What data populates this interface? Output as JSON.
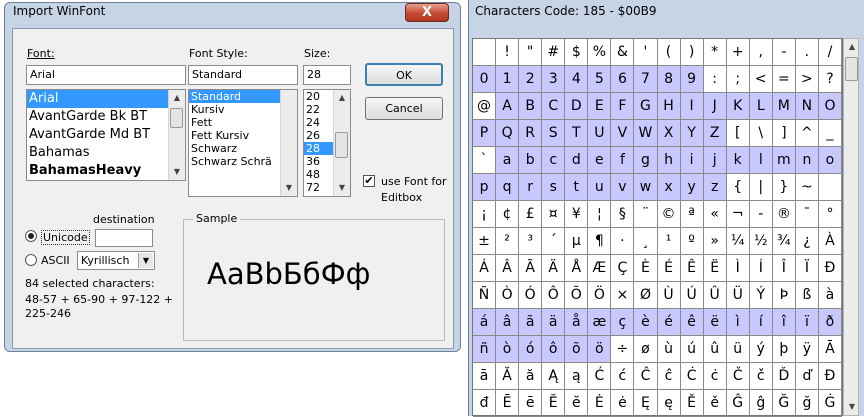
{
  "dialog": {
    "title": "Import WinFont",
    "close_label": "X",
    "font_label": "Font:",
    "font_value": "Arial",
    "fonts": [
      "Arial",
      "AvantGarde Bk BT",
      "AvantGarde Md BT",
      "Bahamas",
      "BahamasHeavy"
    ],
    "selected_font_index": 0,
    "style_label": "Font Style:",
    "style_value": "Standard",
    "styles": [
      "Standard",
      "Kursiv",
      "Fett",
      "Fett Kursiv",
      "Schwarz",
      "Schwarz Schrä"
    ],
    "selected_style_index": 0,
    "size_label": "Size:",
    "size_value": "28",
    "sizes": [
      "20",
      "22",
      "24",
      "26",
      "28",
      "36",
      "48",
      "72"
    ],
    "selected_size_index": 4,
    "ok_label": "OK",
    "cancel_label": "Cancel",
    "use_font_checked": true,
    "use_font_label_1": "use Font for",
    "use_font_label_2": "Editbox",
    "destination_label": "destination",
    "unicode_label": "Unicode",
    "ascii_label": "ASCII",
    "encoding_value": "Kyrillisch",
    "selected_count": "84 selected characters:",
    "ranges_1": "48-57 + 65-90 + 97-122 +",
    "ranges_2": "225-246",
    "sample_label": "Sample",
    "sample_text": "AaBbБбФф",
    "check_mark": "✔"
  },
  "char_panel": {
    "title": "Characters  Code: 185 - $00B9",
    "rows": [
      [
        "",
        "!",
        "\"",
        "#",
        "$",
        "%",
        "&",
        "'",
        "(",
        ")",
        "*",
        "+",
        ",",
        "-",
        ".",
        "/"
      ],
      [
        "0",
        "1",
        "2",
        "3",
        "4",
        "5",
        "6",
        "7",
        "8",
        "9",
        ":",
        ";",
        "<",
        "=",
        ">",
        "?"
      ],
      [
        "@",
        "A",
        "B",
        "C",
        "D",
        "E",
        "F",
        "G",
        "H",
        "I",
        "J",
        "K",
        "L",
        "M",
        "N",
        "O"
      ],
      [
        "P",
        "Q",
        "R",
        "S",
        "T",
        "U",
        "V",
        "W",
        "X",
        "Y",
        "Z",
        "[",
        "\\",
        "]",
        "^",
        "_"
      ],
      [
        "`",
        "a",
        "b",
        "c",
        "d",
        "e",
        "f",
        "g",
        "h",
        "i",
        "j",
        "k",
        "l",
        "m",
        "n",
        "o"
      ],
      [
        "p",
        "q",
        "r",
        "s",
        "t",
        "u",
        "v",
        "w",
        "x",
        "y",
        "z",
        "{",
        "|",
        "}",
        "~",
        ""
      ],
      [
        "¡",
        "¢",
        "£",
        "¤",
        "¥",
        "¦",
        "§",
        "¨",
        "©",
        "ª",
        "«",
        "¬",
        "-",
        "®",
        "¯",
        "°"
      ],
      [
        "±",
        "²",
        "³",
        "´",
        "µ",
        "¶",
        "·",
        "¸",
        "¹",
        "º",
        "»",
        "¼",
        "½",
        "¾",
        "¿",
        "À"
      ],
      [
        "Á",
        "Â",
        "Ã",
        "Ä",
        "Å",
        "Æ",
        "Ç",
        "È",
        "É",
        "Ê",
        "Ë",
        "Ì",
        "Í",
        "Î",
        "Ï",
        "Ð"
      ],
      [
        "Ñ",
        "Ò",
        "Ó",
        "Ô",
        "Õ",
        "Ö",
        "×",
        "Ø",
        "Ù",
        "Ú",
        "Û",
        "Ü",
        "Ý",
        "Þ",
        "ß",
        "à"
      ],
      [
        "á",
        "â",
        "ã",
        "ä",
        "å",
        "æ",
        "ç",
        "è",
        "é",
        "ê",
        "ë",
        "ì",
        "í",
        "î",
        "ï",
        "ð"
      ],
      [
        "ñ",
        "ò",
        "ó",
        "ô",
        "õ",
        "ö",
        "÷",
        "ø",
        "ù",
        "ú",
        "û",
        "ü",
        "ý",
        "þ",
        "ÿ",
        "Ā"
      ],
      [
        "ā",
        "Ă",
        "ă",
        "Ą",
        "ą",
        "Ć",
        "ć",
        "Ĉ",
        "ĉ",
        "Ċ",
        "ċ",
        "Č",
        "č",
        "Ď",
        "ď",
        "Đ"
      ],
      [
        "đ",
        "Ē",
        "ē",
        "Ĕ",
        "ĕ",
        "Ė",
        "ė",
        "Ę",
        "ę",
        "Ě",
        "ě",
        "Ĝ",
        "ĝ",
        "Ğ",
        "ğ",
        "Ġ"
      ]
    ],
    "highlighted": [
      "0",
      "1",
      "2",
      "3",
      "4",
      "5",
      "6",
      "7",
      "8",
      "9",
      "A",
      "B",
      "C",
      "D",
      "E",
      "F",
      "G",
      "H",
      "I",
      "J",
      "K",
      "L",
      "M",
      "N",
      "O",
      "P",
      "Q",
      "R",
      "S",
      "T",
      "U",
      "V",
      "W",
      "X",
      "Y",
      "Z",
      "a",
      "b",
      "c",
      "d",
      "e",
      "f",
      "g",
      "h",
      "i",
      "j",
      "k",
      "l",
      "m",
      "n",
      "o",
      "p",
      "q",
      "r",
      "s",
      "t",
      "u",
      "v",
      "w",
      "x",
      "y",
      "z",
      "á",
      "â",
      "ã",
      "ä",
      "å",
      "æ",
      "ç",
      "è",
      "é",
      "ê",
      "ë",
      "ì",
      "í",
      "î",
      "ï",
      "ð",
      "ñ",
      "ò",
      "ó",
      "ô",
      "õ",
      "ö"
    ],
    "highlight_color": "#c8c8ff"
  },
  "colors": {
    "selection": "#3399ff",
    "frame": "#c6d4e6"
  }
}
